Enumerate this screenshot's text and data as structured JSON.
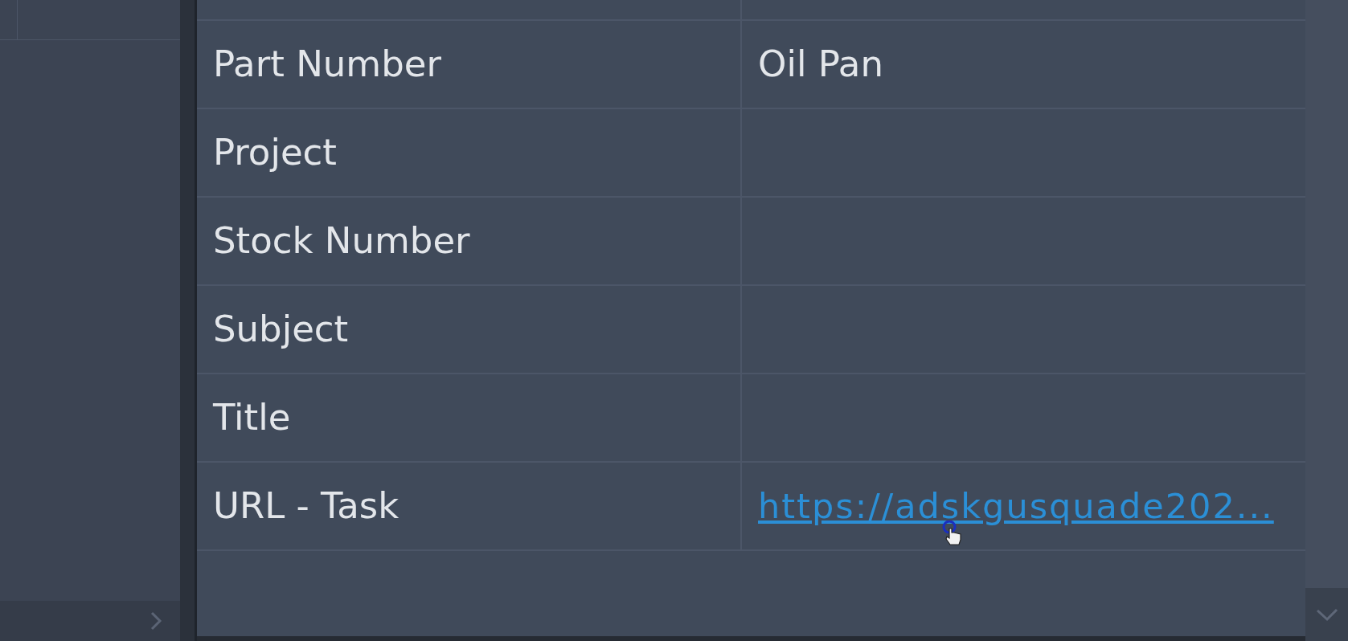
{
  "properties": [
    {
      "name": "Part Number",
      "value": "Oil Pan"
    },
    {
      "name": "Project"
    },
    {
      "name": "Stock Number"
    },
    {
      "name": "Subject"
    },
    {
      "name": "Title"
    },
    {
      "name": "URL - Task",
      "value": "https://adskgusquade202...",
      "kind": "link"
    }
  ]
}
